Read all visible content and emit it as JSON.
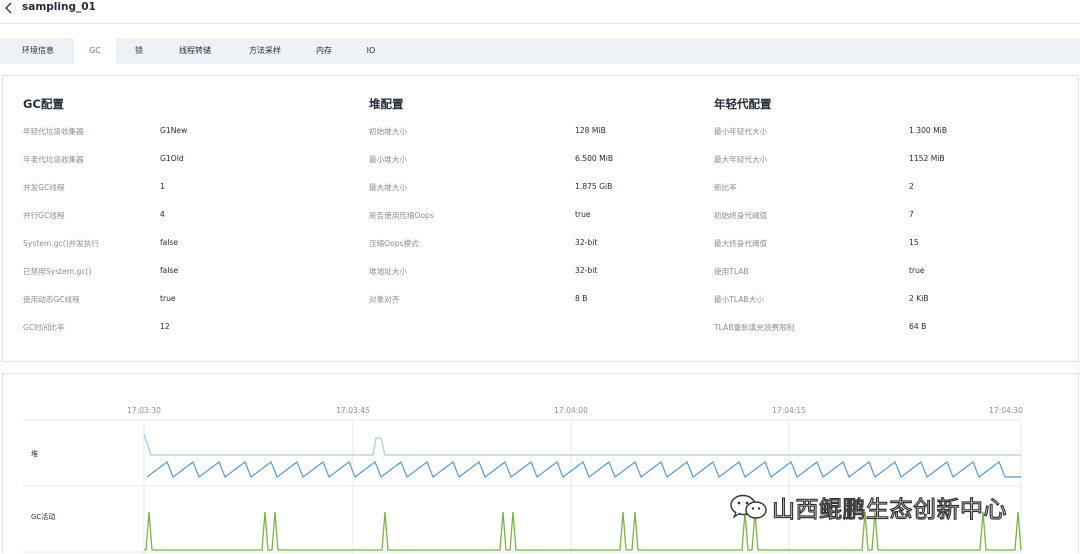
{
  "header": {
    "title": "sampling_01",
    "back_icon": "chevron-left-icon"
  },
  "tabs": [
    {
      "label": "环境信息",
      "active": false
    },
    {
      "label": "GC",
      "active": true
    },
    {
      "label": "锁",
      "active": false
    },
    {
      "label": "线程转储",
      "active": false
    },
    {
      "label": "方法采样",
      "active": false
    },
    {
      "label": "内存",
      "active": false
    },
    {
      "label": "IO",
      "active": false
    }
  ],
  "gc_config": {
    "title": "GC配置",
    "items": [
      {
        "label": "年轻代垃圾收集器",
        "value": "G1New"
      },
      {
        "label": "年老代垃圾收集器",
        "value": "G1Old"
      },
      {
        "label": "并发GC线程",
        "value": "1"
      },
      {
        "label": "并行GC线程",
        "value": "4"
      },
      {
        "label": "System.gc()并发执行",
        "value": "false"
      },
      {
        "label": "已禁用System.gc()",
        "value": "false"
      },
      {
        "label": "使用动态GC线程",
        "value": "true"
      },
      {
        "label": "GC时间比率",
        "value": "12"
      }
    ]
  },
  "heap_config": {
    "title": "堆配置",
    "items": [
      {
        "label": "初始堆大小",
        "value": "128 MiB"
      },
      {
        "label": "最小堆大小",
        "value": "6.500 MiB"
      },
      {
        "label": "最大堆大小",
        "value": "1.875 GiB"
      },
      {
        "label": "是否使用压缩Oops",
        "value": "true"
      },
      {
        "label": "压缩Oops模式",
        "value": "32-bit"
      },
      {
        "label": "堆地址大小",
        "value": "32-bit"
      },
      {
        "label": "对象对齐",
        "value": "8 B"
      }
    ]
  },
  "young_config": {
    "title": "年轻代配置",
    "items": [
      {
        "label": "最小年轻代大小",
        "value": "1.300 MiB"
      },
      {
        "label": "最大年轻代大小",
        "value": "1152 MiB"
      },
      {
        "label": "新比率",
        "value": "2"
      },
      {
        "label": "初始终身代阈值",
        "value": "7"
      },
      {
        "label": "最大终身代阈值",
        "value": "15"
      },
      {
        "label": "使用TLAB",
        "value": "true"
      },
      {
        "label": "最小TLAB大小",
        "value": "2 KiB"
      },
      {
        "label": "TLAB重新填充浪费限制",
        "value": "64 B"
      }
    ]
  },
  "timeline": {
    "time_ticks": [
      "17:03:30",
      "17:03:45",
      "17:04:00",
      "17:04:15",
      "17:04:30"
    ],
    "rows": [
      {
        "label": "堆"
      },
      {
        "label": "GC活动"
      }
    ],
    "colors": {
      "heap_top": "#a9cff0",
      "heap_wave": "#5b9bd5",
      "gc": "#7cb342",
      "grid": "#e8eaee"
    }
  },
  "watermark": {
    "text": "山西鲲鹏生态创新中心",
    "icon": "wechat-icon"
  }
}
